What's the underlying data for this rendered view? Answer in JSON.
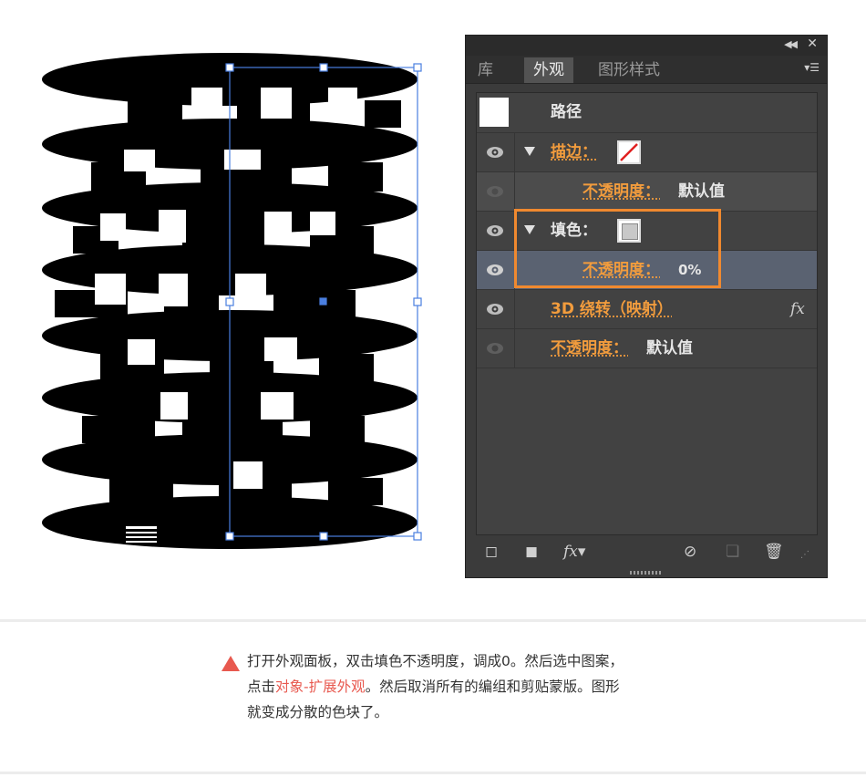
{
  "panel": {
    "tabs": [
      "库",
      "外观",
      "图形样式"
    ],
    "active_tab": "外观",
    "title_row": {
      "label": "路径"
    },
    "stroke_row": {
      "label": "描边：",
      "opacity_label": "不透明度：",
      "opacity_value": "默认值"
    },
    "fill_row": {
      "label": "填色：",
      "opacity_label": "不透明度：",
      "opacity_value": "0%"
    },
    "effect_row": {
      "label": "3D 绕转（映射）",
      "fx": "fx"
    },
    "object_opacity_row": {
      "label": "不透明度：",
      "value": "默认值"
    },
    "bottom_fx": "fx",
    "highlight_color": "#f0892f"
  },
  "caption": {
    "line1": "打开外观面板，双击填色不透明度，调成0。然后选中图案，",
    "line2_pre": "点击",
    "line2_link": "对象-扩展外观",
    "line2_post": "。然后取消所有的编组和剪贴蒙版。图形",
    "line3": "就变成分散的色块了。",
    "accent_color": "#e8594f"
  }
}
